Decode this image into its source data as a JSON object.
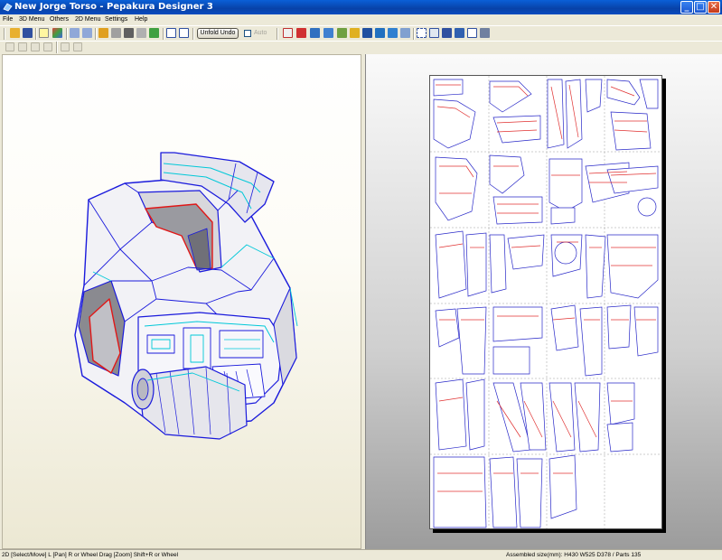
{
  "window": {
    "title": "New Jorge Torso - Pepakura Designer 3",
    "controls": {
      "minimize": "_",
      "maximize": "□",
      "close": "✕"
    }
  },
  "menu": {
    "items": [
      "File",
      "3D Menu",
      "Others",
      "2D Menu",
      "Settings",
      "Help"
    ]
  },
  "toolbar": {
    "unfold_undo_label": "Unfold Undo",
    "auto_label": "Auto",
    "auto_checked": false,
    "icons": [
      "open-icon",
      "save-icon",
      "lightbulb-icon",
      "texture-cube-icon",
      "undo-icon",
      "redo-icon",
      "pencil-icon",
      "join-icon",
      "anchor-icon",
      "flap-icon",
      "refresh-icon",
      "single-view-icon",
      "dual-view-icon",
      "select-icon",
      "pointer-icon",
      "grid-icon",
      "magic-icon",
      "arrange-icon",
      "print-icon",
      "page-icon",
      "move-icon",
      "rotate-icon",
      "swap-icon",
      "fit-icon",
      "zoom-icon",
      "scale-icon",
      "layout-icon",
      "preview-icon"
    ]
  },
  "status": {
    "left": "2D [Select/Move] L [Pan] R or Wheel Drag [Zoom] Shift+R or Wheel",
    "right": "Assembled size(mm): H430 W525 D378 / Parts 135"
  },
  "colors": {
    "titlebar": "#0a4cc0",
    "model_outline": "#1a1adc",
    "model_cyan": "#00c8d8",
    "model_red": "#e01818",
    "part_red": "#e03030",
    "part_blue": "#2828c8"
  }
}
